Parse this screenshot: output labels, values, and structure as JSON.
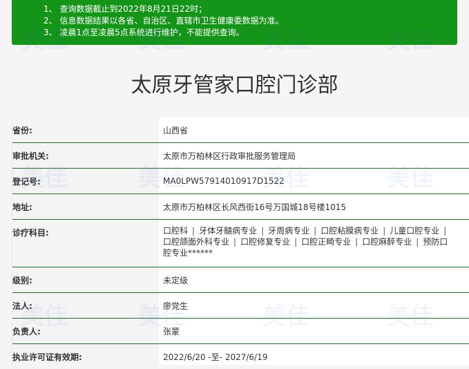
{
  "notice": {
    "items": [
      "1、 查询数据截止到2022年8月21日22时；",
      "2、 信息数据结果以各省、自治区、直辖市卫生健康委数据为准。",
      "3、 凌晨1点至凌晨5点系统进行维护，不能提供查询。"
    ]
  },
  "page_title": "太原牙管家口腔门诊部",
  "fields": {
    "province": {
      "label": "省份:",
      "value": "山西省"
    },
    "approval": {
      "label": "审批机关:",
      "value": "太原市万柏林区行政审批服务管理局"
    },
    "register_no": {
      "label": "登记号:",
      "value": "MA0LPW57914010917D1522"
    },
    "address": {
      "label": "地址:",
      "value": "太原市万柏林区长风西街16号万国城18号楼1015"
    },
    "subjects": {
      "label": "诊疗科目:",
      "items": [
        "口腔科",
        "牙体牙髓病专业",
        "牙周病专业",
        "口腔粘膜病专业",
        "儿童口腔专业",
        "口腔颌面外科专业",
        "口腔修复专业",
        "口腔正畸专业",
        "口腔麻醉专业",
        "预防口腔专业******"
      ]
    },
    "level": {
      "label": "级别:",
      "value": "未定级"
    },
    "legal_person": {
      "label": "法人:",
      "value": "廖党生"
    },
    "principal": {
      "label": "负责人:",
      "value": "张蒙"
    },
    "license_validity": {
      "label": "执业许可证有效期:",
      "value": "2022/6/20 -至- 2027/6/19"
    }
  },
  "watermark": "美佳",
  "colors": {
    "notice_bg": "#149418",
    "row_border": "#1f6a32",
    "label_bg": "#f4f4f4"
  }
}
